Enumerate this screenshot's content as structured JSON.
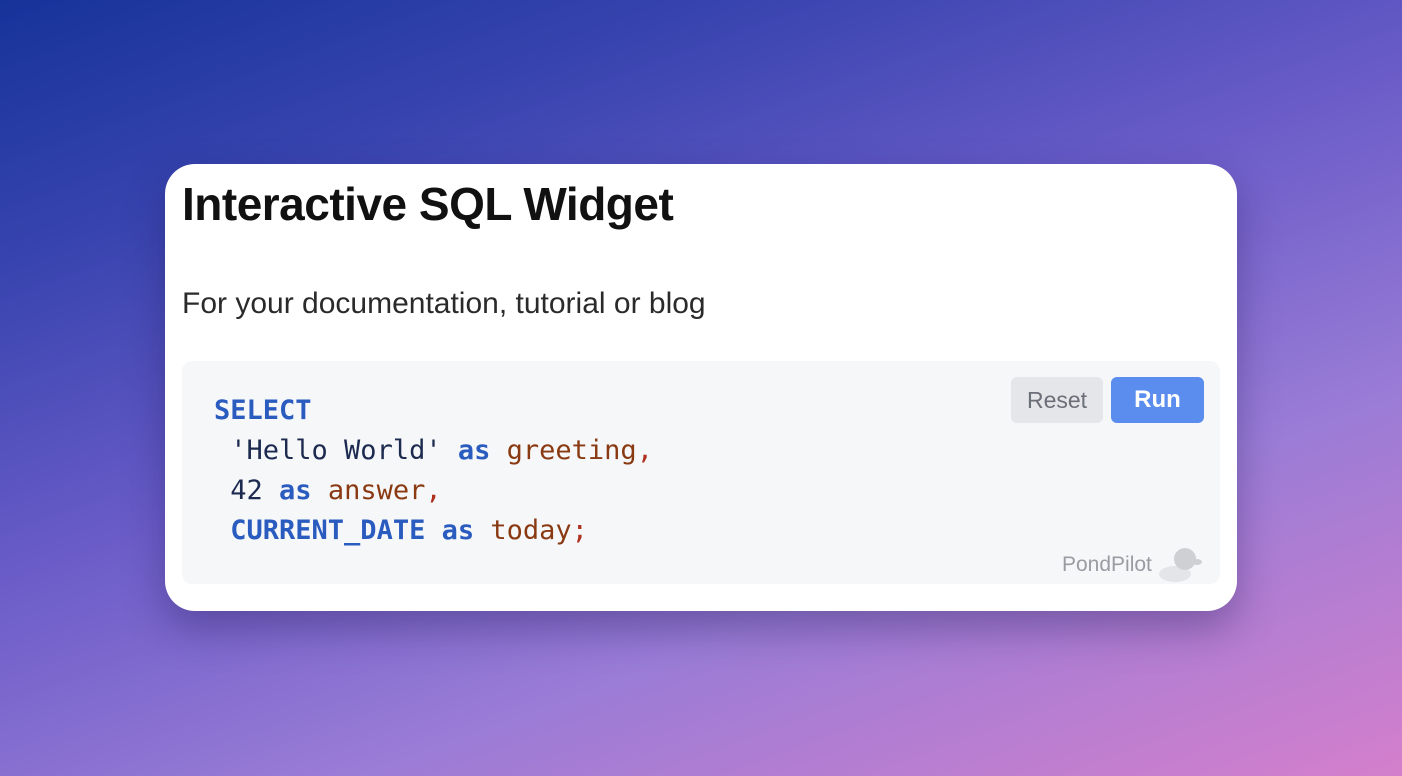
{
  "page": {
    "title": "Interactive SQL Widget",
    "subtitle": "For your documentation, tutorial or blog"
  },
  "widget": {
    "code_lines": [
      [
        {
          "t": "SELECT",
          "k": "kw"
        }
      ],
      [
        {
          "t": " ",
          "k": "str"
        },
        {
          "t": "'Hello World'",
          "k": "str"
        },
        {
          "t": " ",
          "k": "str"
        },
        {
          "t": "as",
          "k": "kw"
        },
        {
          "t": " ",
          "k": "str"
        },
        {
          "t": "greeting",
          "k": "ident"
        },
        {
          "t": ",",
          "k": "punct"
        }
      ],
      [
        {
          "t": " ",
          "k": "str"
        },
        {
          "t": "42",
          "k": "num"
        },
        {
          "t": " ",
          "k": "str"
        },
        {
          "t": "as",
          "k": "kw"
        },
        {
          "t": " ",
          "k": "str"
        },
        {
          "t": "answer",
          "k": "ident"
        },
        {
          "t": ",",
          "k": "punct"
        }
      ],
      [
        {
          "t": " ",
          "k": "str"
        },
        {
          "t": "CURRENT_DATE",
          "k": "kw"
        },
        {
          "t": " ",
          "k": "str"
        },
        {
          "t": "as",
          "k": "kw"
        },
        {
          "t": " ",
          "k": "str"
        },
        {
          "t": "today",
          "k": "ident"
        },
        {
          "t": ";",
          "k": "punct"
        }
      ]
    ],
    "reset_label": "Reset",
    "run_label": "Run",
    "brand_label": "PondPilot",
    "brand_icon": "duck-icon"
  },
  "colors": {
    "run_button": "#5b8def",
    "reset_button": "#e5e6e9",
    "keyword": "#2a5bbf",
    "identifier": "#8a3a12",
    "punctuation": "#b03020"
  }
}
